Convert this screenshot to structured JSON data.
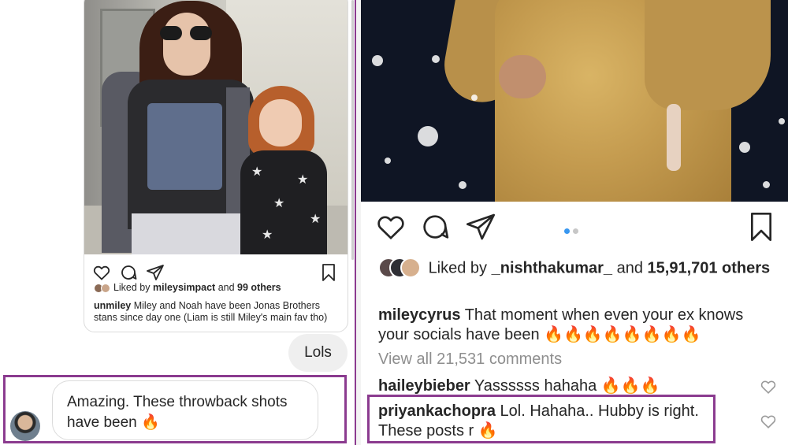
{
  "left_dm": {
    "shared_post": {
      "liked_prefix": "Liked by",
      "liked_user": "mileysimpact",
      "liked_mid": "and",
      "liked_count": "99 others",
      "caption_user": "unmiley",
      "caption_text": "Miley and Noah have been Jonas Brothers stans since day one (Liam is still Miley's main fav tho)"
    },
    "reply_bubble": "Lols",
    "incoming_message": "Amazing. These throwback shots have been 🔥"
  },
  "right_post": {
    "liked_prefix": "Liked by",
    "liked_user": "_nishthakumar_",
    "liked_mid": "and",
    "liked_count": "15,91,701 others",
    "caption_user": "mileycyrus",
    "caption_text": "That moment when even your ex knows your socials have been 🔥🔥🔥🔥🔥🔥🔥🔥",
    "view_all": "View all 21,531 comments",
    "comments": [
      {
        "user": "haileybieber",
        "text": "Yassssss hahaha 🔥🔥🔥"
      },
      {
        "user": "priyankachopra",
        "text": "Lol. Hahaha.. Hubby is right. These posts r 🔥"
      }
    ]
  },
  "colors": {
    "highlight": "#8b3b8f",
    "carousel_active": "#3897f0",
    "muted_text": "#8e8e8e"
  },
  "icons": [
    "heart-icon",
    "comment-icon",
    "share-icon",
    "bookmark-icon"
  ]
}
